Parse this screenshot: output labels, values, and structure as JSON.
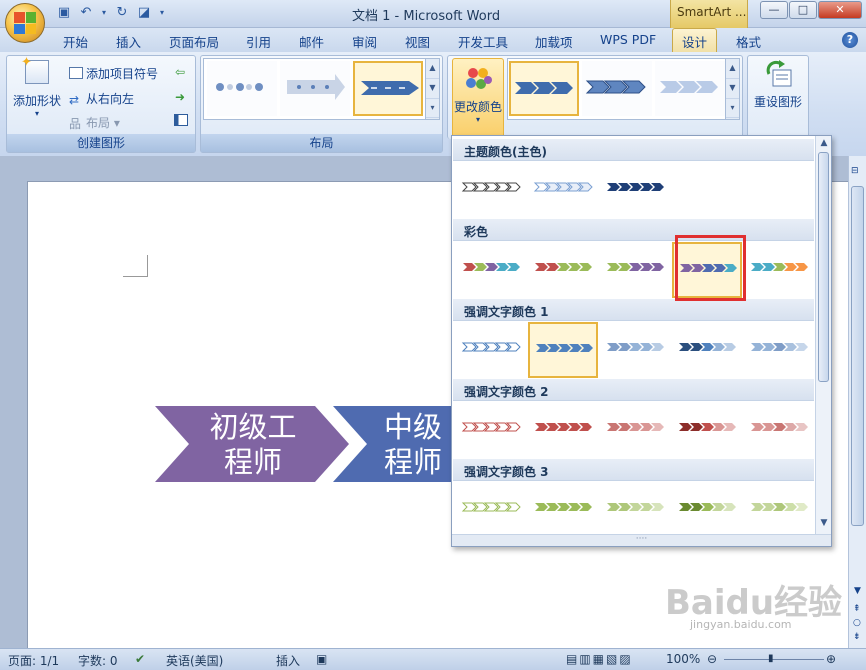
{
  "window": {
    "doc_title": "文档 1 - Microsoft Word",
    "context_tab": "SmartArt ...",
    "minimize": "—",
    "maximize": "□",
    "close": "✕"
  },
  "tabs": [
    {
      "label": "开始"
    },
    {
      "label": "插入"
    },
    {
      "label": "页面布局"
    },
    {
      "label": "引用"
    },
    {
      "label": "邮件"
    },
    {
      "label": "审阅"
    },
    {
      "label": "视图"
    },
    {
      "label": "开发工具"
    },
    {
      "label": "加载项"
    },
    {
      "label": "WPS PDF"
    },
    {
      "label": "设计",
      "active": true
    },
    {
      "label": "格式"
    }
  ],
  "ribbon": {
    "create_group": {
      "label": "创建图形",
      "add_shape": "添加形状",
      "add_bullet": "添加项目符号",
      "right_to_left": "从右向左",
      "layout": "布局"
    },
    "layout_group": {
      "label": "布局"
    },
    "change_colors": "更改颜色",
    "reset_graphic": "重设图形"
  },
  "document": {
    "shapes": [
      {
        "line1": "初级工",
        "line2": "程师",
        "color": "#8064a2"
      },
      {
        "line1": "中级",
        "line2": "程师",
        "color": "#4f6bb0"
      }
    ]
  },
  "dropdown": {
    "sections": [
      {
        "title": "主题颜色(主色)"
      },
      {
        "title": "彩色"
      },
      {
        "title": "强调文字颜色 1"
      },
      {
        "title": "强调文字颜色 2"
      },
      {
        "title": "强调文字颜色 3"
      }
    ],
    "footer": "····"
  },
  "status": {
    "page": "页面: 1/1",
    "words": "字数: 0",
    "language": "英语(美国)",
    "mode": "插入",
    "zoom": "100%"
  },
  "watermark": {
    "text": "Baidu经验",
    "url_text": "jingyan.baidu.com"
  },
  "colors": {
    "accent_selected": "#e7b43e",
    "highlight_box": "#e03030"
  }
}
